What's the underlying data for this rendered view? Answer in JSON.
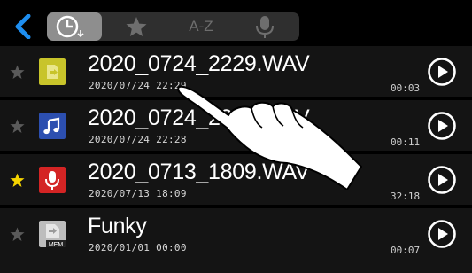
{
  "tabs": {
    "back_icon": "chevron-left-icon",
    "items": [
      {
        "name": "recent",
        "icon": "clock-icon",
        "selected": true
      },
      {
        "name": "favorites",
        "icon": "star-icon"
      },
      {
        "name": "alphabetical",
        "label": "A-Z"
      },
      {
        "name": "voice",
        "icon": "microphone-icon"
      }
    ]
  },
  "files": [
    {
      "favorite": false,
      "icon": "wav-file-icon",
      "icon_color": "#c8c42a",
      "name": "2020_0724_2229.WAV",
      "date": "2020/07/24 22:29",
      "duration": "00:03"
    },
    {
      "favorite": false,
      "icon": "music-note-icon",
      "icon_color": "#2c4fb0",
      "name": "2020_0724_2228.WAV",
      "date": "2020/07/24 22:28",
      "duration": "00:11"
    },
    {
      "favorite": true,
      "icon": "microphone-icon",
      "icon_color": "#d42424",
      "name": "2020_0713_1809.WAV",
      "date": "2020/07/13 18:09",
      "duration": "32:18"
    },
    {
      "favorite": false,
      "icon": "memory-file-icon",
      "icon_color": "#bdbdbd",
      "name": "Funky",
      "date": "2020/01/01 00:00",
      "duration": "00:07"
    }
  ],
  "colors": {
    "accent": "#1e8ef0",
    "favorite_star": "#f5d400",
    "star_inactive": "#5a5a5a",
    "row_bg": "#141414"
  },
  "overlay": {
    "icon": "pointing-hand-icon"
  }
}
